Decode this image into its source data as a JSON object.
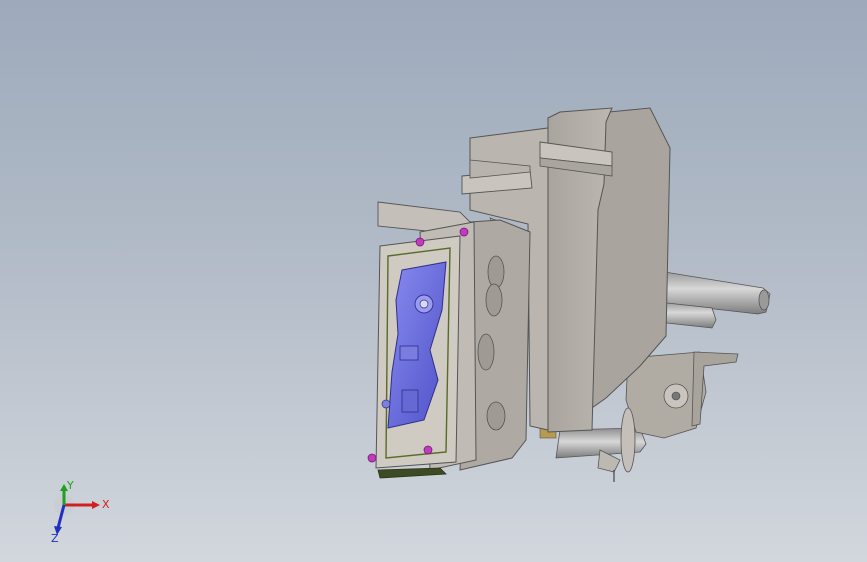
{
  "viewport": {
    "background_top": "#9daabb",
    "background_bottom": "#d2d7dd"
  },
  "model": {
    "body_color": "#b7b3ac",
    "part_color": "#6d6fdc",
    "base_plate_color": "#3e4a24",
    "fastener_color": "#c23ac0",
    "shaft_color": "#a9a9a9"
  },
  "triad": {
    "x_label": "X",
    "y_label": "Y",
    "z_label": "Z",
    "x_color": "#d02020",
    "y_color": "#20a020",
    "z_color": "#2030c0"
  }
}
